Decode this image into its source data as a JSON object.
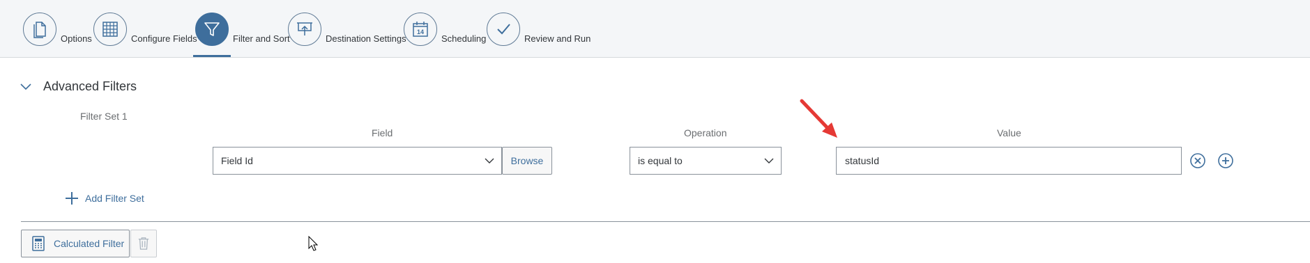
{
  "wizard": {
    "steps": [
      {
        "label": "Options",
        "icon": "document-icon",
        "active": false
      },
      {
        "label": "Configure Fields",
        "icon": "table-grid-icon",
        "active": false
      },
      {
        "label": "Filter and Sort",
        "icon": "filter-icon",
        "active": true
      },
      {
        "label": "Destination Settings",
        "icon": "upload-board-icon",
        "active": false
      },
      {
        "label": "Scheduling",
        "icon": "calendar-icon",
        "active": false
      },
      {
        "label": "Review and Run",
        "icon": "checkmark-icon",
        "active": false
      }
    ],
    "calendar_day": "14"
  },
  "advanced_filters": {
    "title": "Advanced Filters",
    "filter_set_label": "Filter Set 1",
    "columns": {
      "field": "Field",
      "operation": "Operation",
      "value": "Value"
    },
    "row": {
      "field_value": "Field Id",
      "browse_label": "Browse",
      "operation_value": "is equal to",
      "value_text": "statusId"
    },
    "add_filter_set_label": "Add Filter Set"
  },
  "footer": {
    "calculated_filter_label": "Calculated Filter"
  },
  "colors": {
    "accent": "#3e6e9c",
    "annotation_arrow": "#e53935",
    "wizard_bg": "#f4f6f8"
  }
}
